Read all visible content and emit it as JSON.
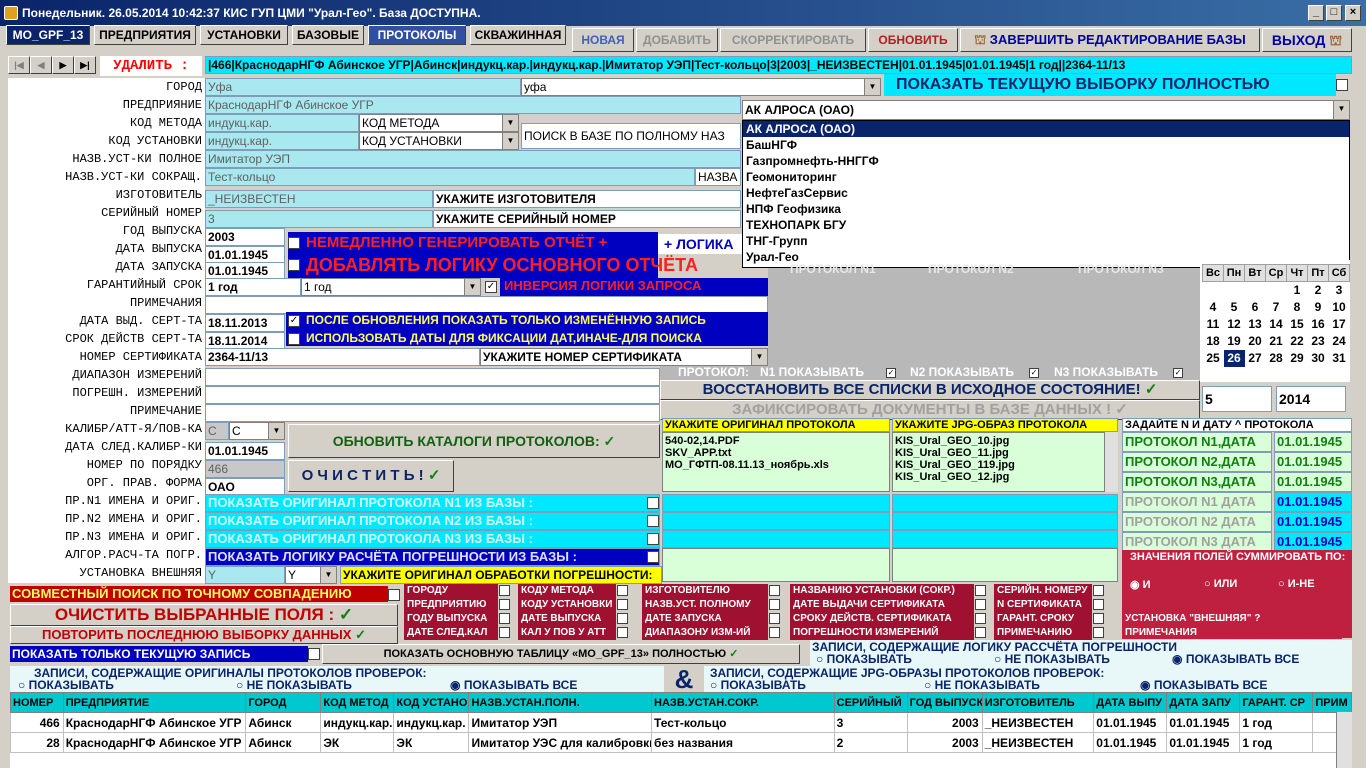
{
  "window": {
    "title": "Понедельник. 26.05.2014 10:42:37  КИС ГУП ЦМИ \"Урал-Гео\". База ДОСТУПНА."
  },
  "tabs": [
    "MO_GPF_13",
    "ПРЕДПРИЯТИЯ",
    "УСТАНОВКИ",
    "БАЗОВЫЕ",
    "ПРОТОКОЛЫ",
    "СКВАЖИННАЯ"
  ],
  "actions": {
    "new": "НОВАЯ",
    "add": "ДОБАВИТЬ",
    "edit": "СКОРРЕКТИРОВАТЬ",
    "refresh": "ОБНОВИТЬ",
    "finish": "ЗАВЕРШИТЬ РЕДАКТИРОВАНИЕ БАЗЫ",
    "exit": "ВЫХОД"
  },
  "nav": {
    "delete": "УДАЛИТЬ :",
    "record": "|466|КраснодарНГФ Абинское УГР|Абинск|индукц.кар.|индукц.кар.|Имитатор УЭП|Тест-кольцо|3|2003|_НЕИЗВЕСТЕН|01.01.1945|01.01.1945|1 год||2364-11/13"
  },
  "show_all": "ПОКАЗАТЬ ТЕКУЩУЮ ВЫБОРКУ ПОЛНОСТЬЮ",
  "labels": [
    "ГОРОД",
    "ПРЕДПРИЯНИЕ",
    "КОД МЕТОДА",
    "КОД УСТАНОВКИ",
    "НАЗВ.УСТ-КИ ПОЛНОЕ",
    "НАЗВ.УСТ-КИ СОКРАЩ.",
    "ИЗГОТОВИТЕЛЬ",
    "СЕРИЙНЫЙ НОМЕР",
    "ГОД ВЫПУСКА",
    "ДАТА ВЫПУСКА",
    "ДАТА ЗАПУСКА",
    "ГАРАНТИЙНЫЙ СРОК",
    "ПРИМЕЧАНИЯ",
    "ДАТА ВЫД. СЕРТ-ТА",
    "СРОК ДЕЙСТВ СЕРТ-ТА",
    "НОМЕР СЕРТИФИКАТА",
    "ДИАПАЗОН ИЗМЕРЕНИЙ",
    "ПОГРЕШН. ИЗМЕРЕНИЙ",
    "ПРИМЕЧАНИЕ",
    "КАЛИБР/АТТ-Я/ПОВ-КА",
    "ДАТА СЛЕД.КАЛИБР-КИ",
    "НОМЕР ПО ПОРЯДКУ",
    "ОРГ. ПРАВ. ФОРМА",
    "ПР.N1 ИМЕНА И ОРИГ.",
    "ПР.N2 ИМЕНА И ОРИГ.",
    "ПР.N3 ИМЕНА И ОРИГ.",
    "АЛГОР.РАСЧ-ТА ПОГР.",
    "УСТАНОВКА ВНЕШНЯЯ"
  ],
  "fields": {
    "city": "Уфа",
    "city_dd": "уфа",
    "company": "КраснодарНГФ Абинское УГР",
    "method": "индукц.кар.",
    "method_dd": "КОД МЕТОДА",
    "install": "индукц.кар.",
    "install_dd": "КОД УСТАНОВКИ",
    "search_full": "ПОИСК В БАЗЕ ПО ПОЛНОМУ НАЗ",
    "full_name": "Имитатор УЭП",
    "short_name": "Тест-кольцо",
    "short_dd": "НАЗВА",
    "maker": "_НЕИЗВЕСТЕН",
    "maker_hint": "УКАЖИТЕ ИЗГОТОВИТЕЛЯ",
    "serial": "3",
    "serial_hint": "УКАЖИТЕ СЕРИЙНЫЙ НОМЕР",
    "year": "2003",
    "date_release": "01.01.1945",
    "date_start": "01.01.1945",
    "warranty": "1 год",
    "warranty_dd": "1 год",
    "cert_issue": "18.11.2013",
    "cert_valid": "18.11.2014",
    "cert_no": "2364-11/13",
    "cert_hint": "УКАЖИТЕ НОМЕР СЕРТИФИКАТА",
    "calib": "С",
    "calib_dd": "С",
    "next_calib": "01.01.1945",
    "order_no": "466",
    "org_form": "ОАО",
    "ext": "Y",
    "ext_dd": "Y"
  },
  "options": {
    "gen_report": "НЕМЕДЛЕННО ГЕНЕРИРОВАТЬ ОТЧЁТ +",
    "logic_btn": "+ ЛОГИКА",
    "add_logic": "ДОБАВЛЯТЬ ЛОГИКУ ОСНОВНОГО ОТЧЁТА",
    "invert": "ИНВЕРСИЯ ЛОГИКИ ЗАПРОСА",
    "show_changed": "ПОСЛЕ ОБНОВЛЕНИЯ ПОКАЗАТЬ ТОЛЬКО ИЗМЕНЁННУЮ ЗАПИСЬ",
    "use_dates": "ИСПОЛЬЗОВАТЬ ДАТЫ ДЛЯ ФИКСАЦИИ ДАТ,ИНАЧЕ-ДЛЯ ПОИСКА"
  },
  "company_dd": {
    "selected": "АК АЛРОСА (ОАО)",
    "items": [
      "АК АЛРОСА (ОАО)",
      "БашНГФ",
      "Газпромнефть-ННГГФ",
      "Геомониторинг",
      "НефтеГазСервис",
      "НПФ Геофизика",
      "ТЕХНОПАРК БГУ",
      "ТНГ-Групп",
      "Урал-Гео"
    ]
  },
  "protocols": {
    "h1": "ПРОТОКОЛ N1",
    "h2": "ПРОТОКОЛ N2",
    "h3": "ПРОТОКОЛ N3",
    "show_label": "ПРОТОКОЛ:",
    "n1": "N1 ПОКАЗЫВАТЬ",
    "n2": "N2 ПОКАЗЫВАТЬ",
    "n3": "N3 ПОКАЗЫВАТЬ",
    "restore": "ВОССТАНОВИТЬ ВСЕ СПИСКИ В ИСХОДНОЕ СОСТОЯНИЕ!",
    "fix": "ЗАФИКСИРОВАТЬ ДОКУМЕНТЫ В БАЗЕ ДАННЫХ !",
    "orig_title": "УКАЖИТЕ ОРИГИНАЛ ПРОТОКОЛА",
    "orig_files": [
      "540-02,14.PDF",
      "SKV_APP.txt",
      "MO_ГФТП-08.11.13_ноябрь.xls"
    ],
    "jpg_title": "УКАЖИТЕ JPG-ОБРАЗ ПРОТОКОЛА",
    "jpg_files": [
      "KIS_Ural_GEO_10.jpg",
      "KIS_Ural_GEO_11.jpg",
      "KIS_Ural_GEO_119.jpg",
      "KIS_Ural_GEO_12.jpg"
    ],
    "date_title": "ЗАДАЙТЕ N И ДАТУ ^ ПРОТОКОЛА",
    "dates": [
      {
        "l": "ПРОТОКОЛ N1,ДАТА",
        "v": "01.01.1945"
      },
      {
        "l": "ПРОТОКОЛ N2,ДАТА",
        "v": "01.01.1945"
      },
      {
        "l": "ПРОТОКОЛ N3,ДАТА",
        "v": "01.01.1945"
      },
      {
        "l": "ПРОТОКОЛ N1 ДАТА",
        "v": "01.01.1945"
      },
      {
        "l": "ПРОТОКОЛ N2 ДАТА",
        "v": "01.01.1945"
      },
      {
        "l": "ПРОТОКОЛ N3 ДАТА",
        "v": "01.01.1945"
      }
    ],
    "show_n1": "ПОКАЗАТЬ ОРИГИНАЛ ПРОТОКОЛА N1 ИЗ БАЗЫ :",
    "show_n2": "ПОКАЗАТЬ ОРИГИНАЛ ПРОТОКОЛА N2 ИЗ БАЗЫ :",
    "show_n3": "ПОКАЗАТЬ ОРИГИНАЛ ПРОТОКОЛА N3 ИЗ БАЗЫ :",
    "show_logic": "ПОКАЗАТЬ ЛОГИКУ РАСЧЁТА ПОГРЕШНОСТИ ИЗ БАЗЫ :",
    "err_orig": "УКАЖИТЕ ОРИГИНАЛ ОБРАБОТКИ ПОГРЕШНОСТИ:"
  },
  "calendar": {
    "days": [
      "Вс",
      "Пн",
      "Вт",
      "Ср",
      "Чт",
      "Пт",
      "Сб"
    ],
    "weeks": [
      [
        "",
        "",
        "",
        "",
        "1",
        "2",
        "3"
      ],
      [
        "4",
        "5",
        "6",
        "7",
        "8",
        "9",
        "10"
      ],
      [
        "11",
        "12",
        "13",
        "14",
        "15",
        "16",
        "17"
      ],
      [
        "18",
        "19",
        "20",
        "21",
        "22",
        "23",
        "24"
      ],
      [
        "25",
        "26",
        "27",
        "28",
        "29",
        "30",
        "31"
      ]
    ],
    "selected": "26",
    "day": "5",
    "year": "2014"
  },
  "buttons": {
    "update_catalogs": "ОБНОВИТЬ КАТАЛОГИ ПРОТОКОЛОВ:",
    "clear": "О Ч И С Т И Т Ь !",
    "joint": "СОВМЕСТНЫЙ ПОИСК ПО ТОЧНОМУ СОВПАДЕНИЮ",
    "clear_fields": "ОЧИСТИТЬ  ВЫБРАННЫЕ  ПОЛЯ :",
    "repeat": "ПОВТОРИТЬ ПОСЛЕДНЮЮ ВЫБОРКУ ДАННЫХ",
    "only_current": "ПОКАЗАТЬ ТОЛЬКО ТЕКУЩУЮ ЗАПИСЬ",
    "show_main": "ПОКАЗАТЬ  ОСНОВНУЮ  ТАБЛИЦУ  «MO_GPF_13»  ПОЛНОСТЬЮ"
  },
  "clear_opts": [
    [
      "ГОРОДУ",
      "ПРЕДПРИЯТИЮ",
      "ГОДУ ВЫПУСКА",
      "ДАТЕ СЛЕД.КАЛ"
    ],
    [
      "КОДУ МЕТОДА",
      "КОДУ УСТАНОВКИ",
      "ДАТЕ ВЫПУСКА",
      "КАЛ У ПОВ У АТТ"
    ],
    [
      "ИЗГОТОВИТЕЛЮ",
      "НАЗВ.УСТ. ПОЛНОМУ",
      "ДАТЕ ЗАПУСКА",
      "ДИАПАЗОНУ ИЗМ-ИЙ"
    ],
    [
      "НАЗВАНИЮ УСТАНОВКИ (СОКР.)",
      "ДАТЕ ВЫДАЧИ СЕРТИФИКАТА",
      "СРОКУ ДЕЙСТВ. СЕРТИФИКАТА",
      "ПОГРЕШНОСТИ ИЗМЕРЕНИЙ"
    ],
    [
      "СЕРИЙН. НОМЕРУ",
      "N СЕРТИФИКАТА",
      "ГАРАНТ. СРОКУ",
      "ПРИМЕЧАНИЮ"
    ]
  ],
  "sum": {
    "title": "ЗНАЧЕНИЯ ПОЛЕЙ СУММИРОВАТЬ ПО:",
    "and": "И",
    "or": "ИЛИ",
    "andnot": "И-НЕ",
    "ext": "УСТАНОВКА \"ВНЕШНЯЯ\" ?",
    "notes": "ПРИМЕЧАНИЯ"
  },
  "records": {
    "orig_title": "ЗАПИСИ, СОДЕРЖАЩИЕ ОРИГИНАЛЫ ПРОТОКОЛОВ ПРОВЕРОК:",
    "logic_title": "ЗАПИСИ, СОДЕРЖАЩИЕ ЛОГИКУ  РАССЧЁТА ПОГРЕШНОСТИ",
    "jpg_title": "ЗАПИСИ, СОДЕРЖАЩИЕ JPG-ОБРАЗЫ ПРОТОКОЛОВ ПРОВЕРОК:",
    "show": "ПОКАЗЫВАТЬ",
    "noshow": "НЕ ПОКАЗЫВАТЬ",
    "all": "ПОКАЗЫВАТЬ ВСЕ",
    "amp": "&"
  },
  "table": {
    "columns": [
      "НОМЕР",
      "ПРЕДПРИЯТИЕ",
      "ГОРОД",
      "КОД МЕТОД",
      "КОД УСТАНО",
      "НАЗВ.УСТАН.ПОЛН.",
      "НАЗВ.УСТАН.СОКР.",
      "СЕРИЙНЫЙ",
      "ГОД ВЫПУСК",
      "ИЗГОТОВИТЕЛЬ",
      "ДАТА ВЫПУ",
      "ДАТА ЗАПУ",
      "ГАРАНТ. СР",
      "ПРИМ"
    ],
    "rows": [
      [
        "466",
        "КраснодарНГФ Абинское УГР",
        "Абинск",
        "индукц.кар.",
        "индукц.кар.",
        "Имитатор УЭП",
        "Тест-кольцо",
        "3",
        "2003",
        "_НЕИЗВЕСТЕН",
        "01.01.1945",
        "01.01.1945",
        "1 год",
        ""
      ],
      [
        "28",
        "КраснодарНГФ Абинское УГР",
        "Абинск",
        "ЭК",
        "ЭК",
        "Имитатор УЭС для калибровки",
        "без названия",
        "2",
        "2003",
        "_НЕИЗВЕСТЕН",
        "01.01.1945",
        "01.01.1945",
        "1 год",
        ""
      ]
    ]
  }
}
